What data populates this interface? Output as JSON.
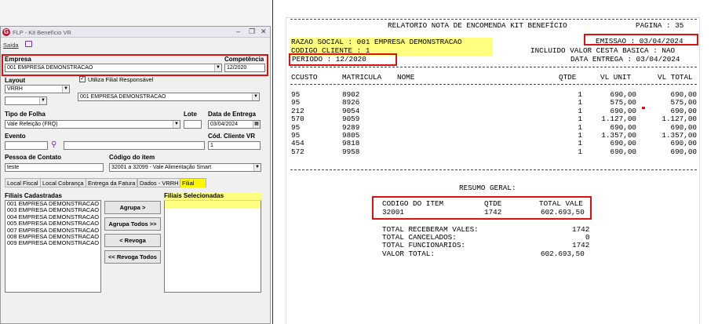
{
  "window": {
    "title": "FLP - Kit Benefício VR",
    "menu_label": "Saída",
    "minimize": "–",
    "restore": "❐",
    "close": "✕"
  },
  "form": {
    "empresa_label": "Empresa",
    "empresa_value": "001 EMPRESA DEMONSTRACAO",
    "competencia_label": "Competência",
    "competencia_value": "12/2020",
    "layout_label": "Layout",
    "layout_value": "VRRH",
    "utiliza_filial_label": "Utiliza Filial Responsável",
    "filial_responsavel_value": "001 EMPRESA DEMONSTRACAO",
    "tipo_folha_label": "Tipo de Folha",
    "tipo_folha_value": "Vale Refeição (FRQ)",
    "lote_label": "Lote",
    "lote_value": "",
    "data_entrega_label": "Data de Entrega",
    "data_entrega_value": "03/04/2024",
    "evento_label": "Evento",
    "evento_value": "",
    "cod_cliente_label": "Cód. Cliente VR",
    "cod_cliente_value": "1",
    "pessoa_contato_label": "Pessoa de Contato",
    "pessoa_contato_value": "teste",
    "codigo_item_label": "Código do item",
    "codigo_item_value": "32001 a 32099 - Vale Alimentação Smart"
  },
  "tabs": [
    "Local Fiscal",
    "Local Cobrança",
    "Entrega da Fatura",
    "Dados - VRRH",
    "Filial"
  ],
  "filiais": {
    "cadastradas_label": "Filiais Cadastradas",
    "selecionadas_label": "Filiais Selecionadas",
    "cadastradas": [
      "001 EMPRESA DEMONSTRACAO",
      "003 EMPRESA DEMONSTRACAO",
      "004 EMPRESA DEMONSTRACAO",
      "005 EMPRESA DEMONSTRACAO",
      "007 EMPRESA DEMONSTRACAO",
      "008 EMPRESA DEMONSTRACAO",
      "009 EMPRESA DEMONSTRACAO"
    ],
    "buttons": {
      "agrupa": "Agrupa >",
      "agrupa_todos": "Agrupa Todos >>",
      "revoga": "< Revoga",
      "revoga_todos": "<< Revoga Todos"
    }
  },
  "report": {
    "title": "RELATORIO NOTA DE ENCOMENDA KIT BENEFÍCIO",
    "pagina": "PAGINA : 35",
    "razao_social": "RAZAO SOCIAL : 001 EMPRESA DEMONSTRACAO",
    "emissao": "EMISSAO : 03/04/2024",
    "codigo_cliente": "CODIGO CLIENTE : 1",
    "incluido_valor": "INCLUIDO VALOR CESTA BASICA : NAO",
    "periodo": "PERIODO : 12/2020",
    "data_entrega": "DATA ENTREGA : 03/04/2024",
    "headers": [
      "CCUSTO",
      "MATRICULA",
      "NOME",
      "QTDE",
      "VL UNIT",
      "VL TOTAL"
    ],
    "rows": [
      [
        "95",
        "8902",
        "",
        "1",
        "690,00",
        "690,00"
      ],
      [
        "95",
        "8926",
        "",
        "1",
        "575,00",
        "575,00"
      ],
      [
        "212",
        "9054",
        "",
        "1",
        "690,00",
        "690,00"
      ],
      [
        "570",
        "9059",
        "",
        "1",
        "1.127,00",
        "1.127,00"
      ],
      [
        "95",
        "9289",
        "",
        "1",
        "690,00",
        "690,00"
      ],
      [
        "95",
        "9805",
        "",
        "1",
        "1.357,00",
        "1.357,00"
      ],
      [
        "454",
        "9818",
        "",
        "1",
        "690,00",
        "690,00"
      ],
      [
        "572",
        "9958",
        "",
        "1",
        "690,00",
        "690,00"
      ]
    ],
    "resumo_title": "RESUMO GERAL:",
    "resumo_headers": [
      "CODIGO DO ITEM",
      "QTDE",
      "TOTAL VALE"
    ],
    "resumo_row": [
      "32001",
      "1742",
      "602.693,50"
    ],
    "totals": [
      [
        "TOTAL RECEBERAM VALES:",
        "1742"
      ],
      [
        "TOTAL CANCELADOS:",
        "0"
      ],
      [
        "TOTAL FUNCIONARIOS:",
        "1742"
      ],
      [
        "VALOR TOTAL:",
        "602.693,50"
      ]
    ]
  }
}
